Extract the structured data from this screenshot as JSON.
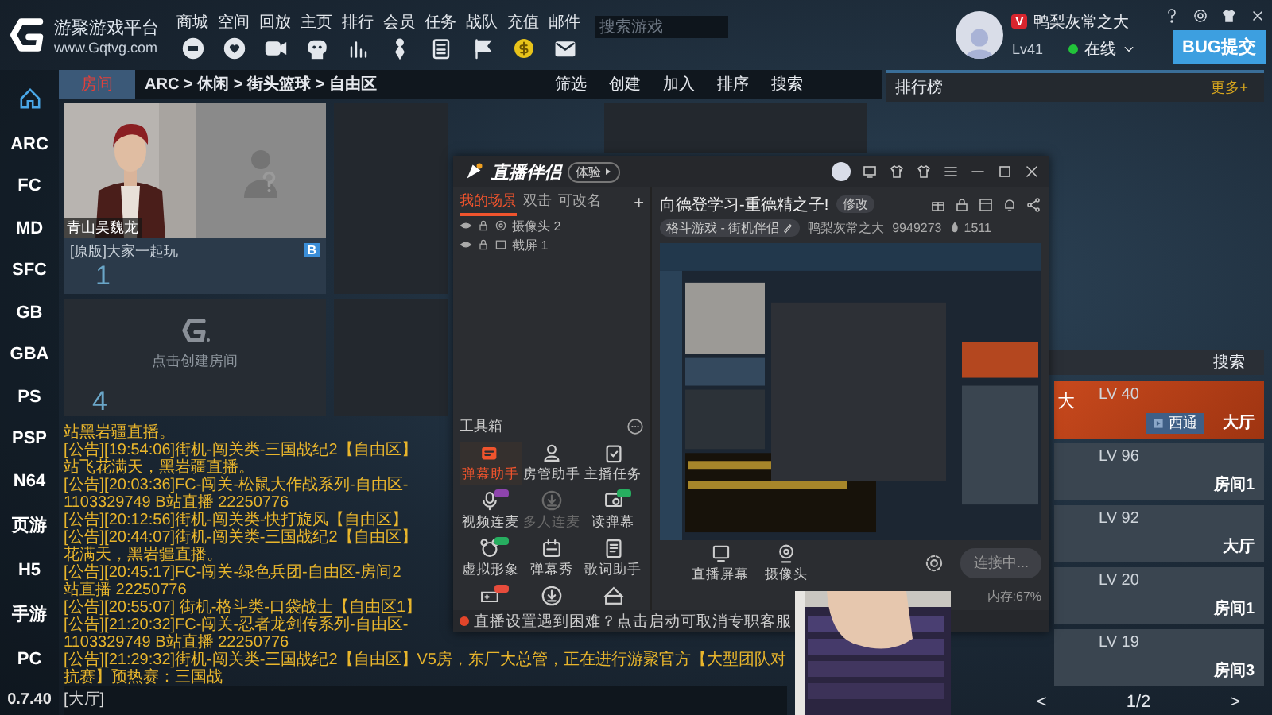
{
  "header": {
    "logo_title": "游聚游戏平台",
    "logo_url": "www.Gqtvg.com",
    "nav": [
      {
        "label": "商城",
        "kind": "shop"
      },
      {
        "label": "空间",
        "kind": "space"
      },
      {
        "label": "回放",
        "kind": "replay"
      },
      {
        "label": "主页",
        "kind": "home"
      },
      {
        "label": "排行",
        "kind": "rank"
      },
      {
        "label": "会员",
        "kind": "member"
      },
      {
        "label": "任务",
        "kind": "task"
      },
      {
        "label": "战队",
        "kind": "team"
      },
      {
        "label": "充值",
        "kind": "recharge"
      },
      {
        "label": "邮件",
        "kind": "mail"
      }
    ],
    "search": {
      "placeholder": "搜索游戏"
    },
    "user": {
      "vip_badge": "V",
      "name": "鸭梨灰常之大",
      "level": "Lv41",
      "status": "在线"
    },
    "bug_button": "BUG提交"
  },
  "sidebar": {
    "items": [
      {
        "kind": "home",
        "selected": true
      },
      {
        "kind": "text",
        "label": "ARC",
        "selected": false
      },
      {
        "kind": "text",
        "label": "FC",
        "selected": false
      },
      {
        "kind": "text",
        "label": "MD",
        "selected": false
      },
      {
        "kind": "text",
        "label": "SFC",
        "selected": false
      },
      {
        "kind": "text",
        "label": "GB",
        "selected": false
      },
      {
        "kind": "text",
        "label": "GBA",
        "selected": false
      },
      {
        "kind": "text",
        "label": "PS",
        "selected": false
      },
      {
        "kind": "text",
        "label": "PSP",
        "selected": false
      },
      {
        "kind": "text",
        "label": "N64",
        "selected": false
      },
      {
        "kind": "text",
        "label": "页游",
        "selected": false
      },
      {
        "kind": "text",
        "label": "H5",
        "selected": false
      },
      {
        "kind": "text",
        "label": "手游",
        "selected": false
      },
      {
        "kind": "text",
        "label": "PC",
        "selected": false
      }
    ],
    "version": "0.7.40"
  },
  "room_bar": {
    "tab": "房间",
    "breadcrumb": "ARC > 休闲 > 街头篮球 > 自由区",
    "actions": [
      "筛选",
      "创建",
      "加入",
      "排序",
      "搜索"
    ]
  },
  "rooms": [
    {
      "kind": "occupied",
      "player": "青山吴魏龙",
      "title": "[原版]大家一起玩",
      "badge": "B",
      "number": "1"
    },
    {
      "kind": "empty"
    },
    {
      "kind": "empty"
    },
    {
      "kind": "create",
      "label": "点击创建房间",
      "number": "4"
    },
    {
      "kind": "empty"
    }
  ],
  "chat": {
    "lines": [
      "站黑岩疆直播。",
      "[公告][19:54:06]街机-闯关类-三国战纪2【自由区】",
      "站飞花满天，黑岩疆直播。",
      "[公告][20:03:36]FC-闯关-松鼠大作战系列-自由区-",
      "1103329749 B站直播 22250776",
      "[公告][20:12:56]街机-闯关类-快打旋风【自由区】",
      "[公告][20:44:07]街机-闯关类-三国战纪2【自由区】",
      "花满天，黑岩疆直播。",
      "[公告][20:45:17]FC-闯关-绿色兵团-自由区-房间2",
      "站直播 22250776",
      "[公告][20:55:07] 街机-格斗类-口袋战士【自由区1】",
      "[公告][21:20:32]FC-闯关-忍者龙剑传系列-自由区-",
      "1103329749 B站直播 22250776",
      "[公告][21:29:32]街机-闯关类-三国战纪2【自由区】V5房，东厂大总管，正在进行游聚官方【大型团队对抗赛】预热赛：三国战"
    ],
    "input_label": "[大厅]"
  },
  "ranking": {
    "title": "排行榜",
    "more": "更多+",
    "search": "搜索",
    "rows": [
      {
        "name": "大",
        "level": "LV 40",
        "tag": "西通",
        "location": "大厅",
        "selected": true
      },
      {
        "level": "LV 96",
        "location": "房间1",
        "selected": false
      },
      {
        "level": "LV 92",
        "location": "大厅",
        "selected": false
      },
      {
        "level": "LV 20",
        "location": "房间1",
        "selected": false
      },
      {
        "level": "LV 19",
        "location": "房间3",
        "selected": false
      }
    ],
    "prev": "<",
    "page": "1/2",
    "next": ">"
  },
  "stream_app": {
    "title": "直播伴侣",
    "badge": "体验",
    "scene_tabs": [
      {
        "label": "我的场景",
        "selected": true
      },
      {
        "label": "双击",
        "selected": false
      },
      {
        "label": "可改名",
        "selected": false
      }
    ],
    "add": "+",
    "sources": [
      {
        "kind": "camera",
        "label": "摄像头 2"
      },
      {
        "kind": "screen",
        "label": "截屏 1"
      }
    ],
    "toolbox": "工具箱",
    "tools": [
      {
        "kind": "danmaku",
        "label": "弹幕助手",
        "selected": true,
        "disabled": false
      },
      {
        "kind": "person",
        "label": "房管助手",
        "selected": false,
        "disabled": false
      },
      {
        "kind": "clipboard",
        "label": "主播任务",
        "selected": false,
        "disabled": false
      },
      {
        "kind": "mic",
        "label": "视频连麦",
        "color": "#8e44ad",
        "selected": false,
        "disabled": false
      },
      {
        "kind": "download",
        "label": "多人连麦",
        "selected": false,
        "disabled": true
      },
      {
        "kind": "display",
        "label": "读弹幕",
        "color": "#27ae60",
        "selected": false,
        "disabled": false
      },
      {
        "kind": "face",
        "label": "虚拟形象",
        "color": "#27ae60",
        "selected": false,
        "disabled": false
      },
      {
        "kind": "calendar",
        "label": "弹幕秀",
        "selected": false,
        "disabled": false
      },
      {
        "kind": "doc",
        "label": "歌词助手",
        "selected": false,
        "disabled": false
      },
      {
        "kind": "game",
        "color": "#e74c3c",
        "selected": false,
        "disabled": false
      },
      {
        "kind": "download",
        "selected": false,
        "disabled": false
      },
      {
        "kind": "cake",
        "selected": false,
        "disabled": false
      }
    ],
    "live_title": "向德登学习-重德精之子!",
    "edit": "修改",
    "category": "格斗游戏 - 街机伴侣",
    "anchor": "鸭梨灰常之大",
    "room_id": "9949273",
    "heat": "1511",
    "controls": [
      {
        "kind": "screen",
        "label": "直播屏幕"
      },
      {
        "kind": "camera",
        "label": "摄像头"
      }
    ],
    "connect_button": "连接中...",
    "memory": "内存:67%",
    "notice": "直播设置遇到困难？点击启动可取消专职客服"
  }
}
